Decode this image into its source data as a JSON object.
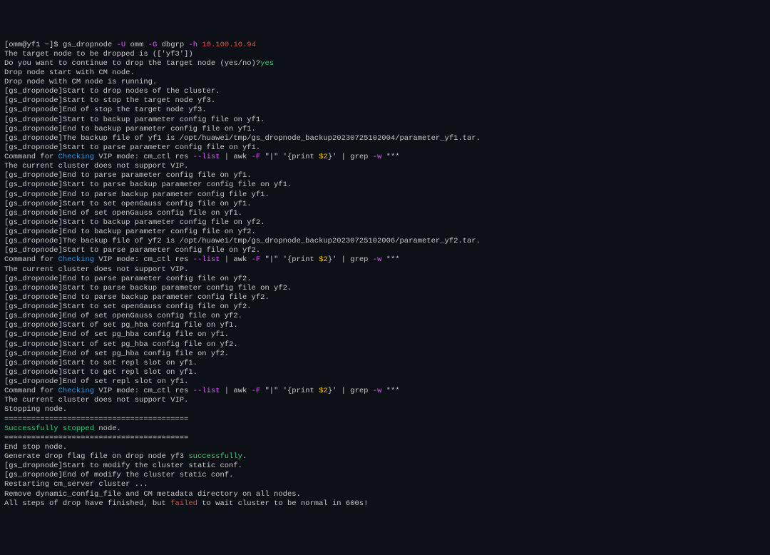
{
  "prompt": {
    "user_host": "[omm@yf1 ~]$",
    "cmd": "gs_dropnode",
    "flag_U": "-U",
    "val_U": "omm",
    "flag_G": "-G",
    "val_G": "dbgrp",
    "flag_h": "-h",
    "val_h": "10.100.10.94"
  },
  "lines": {
    "l1": "The target node to be dropped is (['yf3'])",
    "l2a": "Do you want to continue to drop the target node (yes/no)?",
    "l2b": "yes",
    "l3": "Drop node start with CM node.",
    "l4": "Drop node with CM node is running.",
    "l5": "[gs_dropnode]Start to drop nodes of the cluster.",
    "l6": "[gs_dropnode]Start to stop the target node yf3.",
    "l7": "[gs_dropnode]End of stop the target node yf3.",
    "l8": "[gs_dropnode]Start to backup parameter config file on yf1.",
    "l9": "[gs_dropnode]End to backup parameter config file on yf1.",
    "l10": "[gs_dropnode]The backup file of yf1 is /opt/huawei/tmp/gs_dropnode_backup20230725102004/parameter_yf1.tar.",
    "l11": "[gs_dropnode]Start to parse parameter config file on yf1.",
    "cmdline": {
      "a": "Command for ",
      "b": "Checking",
      "c": " VIP mode: cm_ctl res ",
      "d": "--list",
      "e": " | awk ",
      "f": "-F",
      "g": " \"|\" '{print ",
      "h": "$2",
      "i": "}' | grep ",
      "j": "-w",
      "k": " ***"
    },
    "l13": "The current cluster does not support VIP.",
    "l14": "[gs_dropnode]End to parse parameter config file on yf1.",
    "l15": "[gs_dropnode]Start to parse backup parameter config file on yf1.",
    "l16": "[gs_dropnode]End to parse backup parameter config file yf1.",
    "l17": "[gs_dropnode]Start to set openGauss config file on yf1.",
    "l18": "[gs_dropnode]End of set openGauss config file on yf1.",
    "l19": "[gs_dropnode]Start to backup parameter config file on yf2.",
    "l20": "[gs_dropnode]End to backup parameter config file on yf2.",
    "l21": "[gs_dropnode]The backup file of yf2 is /opt/huawei/tmp/gs_dropnode_backup20230725102006/parameter_yf2.tar.",
    "l22": "[gs_dropnode]Start to parse parameter config file on yf2.",
    "l24": "The current cluster does not support VIP.",
    "l25": "[gs_dropnode]End to parse parameter config file on yf2.",
    "l26": "[gs_dropnode]Start to parse backup parameter config file on yf2.",
    "l27": "[gs_dropnode]End to parse backup parameter config file yf2.",
    "l28": "[gs_dropnode]Start to set openGauss config file on yf2.",
    "l29": "[gs_dropnode]End of set openGauss config file on yf2.",
    "l30": "[gs_dropnode]Start of set pg_hba config file on yf1.",
    "l31": "[gs_dropnode]End of set pg_hba config file on yf1.",
    "l32": "[gs_dropnode]Start of set pg_hba config file on yf2.",
    "l33": "[gs_dropnode]End of set pg_hba config file on yf2.",
    "l34": "[gs_dropnode]Start to set repl slot on yf1.",
    "l35": "[gs_dropnode]Start to get repl slot on yf1.",
    "l36": "[gs_dropnode]End of set repl slot on yf1.",
    "l38": "The current cluster does not support VIP.",
    "l39": "Stopping node.",
    "sep1": "=========================================",
    "succ_a": "Successfully",
    "succ_b": " stopped",
    "succ_c": " node.",
    "sep2": "=========================================",
    "l42": "End stop node.",
    "l43a": "Generate drop flag file on drop node yf3 ",
    "l43b": "successfully",
    "l43c": ".",
    "l44": "[gs_dropnode]Start to modify the cluster static conf.",
    "l45": "[gs_dropnode]End of modify the cluster static conf.",
    "l46": "Restarting cm_server cluster ...",
    "l47": "Remove dynamic_config_file and CM metadata directory on all nodes.",
    "l48a": "All steps of drop have finished, but ",
    "l48b": "failed",
    "l48c": " to wait cluster to be normal in 600s!"
  }
}
